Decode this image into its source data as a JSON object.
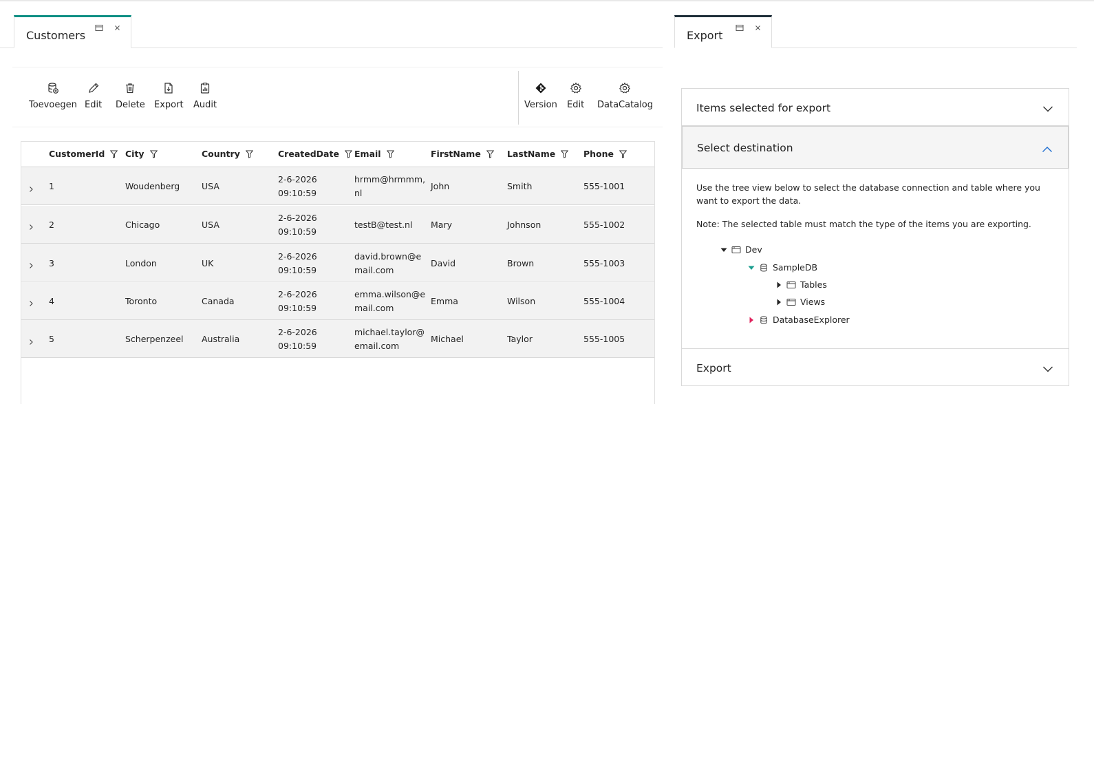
{
  "left_tab": {
    "title": "Customers"
  },
  "right_tab": {
    "title": "Export"
  },
  "toolbar": {
    "left_buttons": [
      {
        "label": "Toevoegen",
        "icon": "database-add-icon"
      },
      {
        "label": "Edit",
        "icon": "pencil-icon"
      },
      {
        "label": "Delete",
        "icon": "trash-icon"
      },
      {
        "label": "Export",
        "icon": "document-export-icon"
      },
      {
        "label": "Audit",
        "icon": "clipboard-chart-icon"
      }
    ],
    "right_buttons": [
      {
        "label": "Version",
        "icon": "git-diamond-icon"
      },
      {
        "label": "Edit",
        "icon": "gear-icon"
      },
      {
        "label": "DataCatalog",
        "icon": "gear-icon"
      }
    ]
  },
  "grid": {
    "columns": [
      "CustomerId",
      "City",
      "Country",
      "CreatedDate",
      "Email",
      "FirstName",
      "LastName",
      "Phone"
    ],
    "rows": [
      {
        "id": "1",
        "city": "Woudenberg",
        "country": "USA",
        "date": "2-6-2026",
        "time": "09:10:59",
        "email1": "hrmm@hrmmm,",
        "email2": "nl",
        "first": "John",
        "last": "Smith",
        "phone": "555-1001"
      },
      {
        "id": "2",
        "city": "Chicago",
        "country": "USA",
        "date": "2-6-2026",
        "time": "09:10:59",
        "email1": "testB@test.nl",
        "email2": "",
        "first": "Mary",
        "last": "Johnson",
        "phone": "555-1002"
      },
      {
        "id": "3",
        "city": "London",
        "country": "UK",
        "date": "2-6-2026",
        "time": "09:10:59",
        "email1": "david.brown@e",
        "email2": "mail.com",
        "first": "David",
        "last": "Brown",
        "phone": "555-1003"
      },
      {
        "id": "4",
        "city": "Toronto",
        "country": "Canada",
        "date": "2-6-2026",
        "time": "09:10:59",
        "email1": "emma.wilson@e",
        "email2": "mail.com",
        "first": "Emma",
        "last": "Wilson",
        "phone": "555-1004"
      },
      {
        "id": "5",
        "city": "Scherpenzeel",
        "country": "Australia",
        "date": "2-6-2026",
        "time": "09:10:59",
        "email1": "michael.taylor@",
        "email2": "email.com",
        "first": "Michael",
        "last": "Taylor",
        "phone": "555-1005"
      }
    ]
  },
  "export_panel": {
    "sections": [
      {
        "title": "Items selected for export",
        "expanded": false
      },
      {
        "title": "Select destination",
        "expanded": true
      },
      {
        "title": "Export",
        "expanded": false
      }
    ],
    "description": "Use the tree view below to select the database connection and table where you want to export the data.",
    "note": "Note: The selected table must match the type of the items you are exporting.",
    "tree": [
      {
        "label": "Dev",
        "icon": "folder-window-icon",
        "state": "expanded",
        "caret_color": "#242424"
      },
      {
        "label": "SampleDB",
        "icon": "database-icon",
        "state": "expanded",
        "caret_color": "#1a9e8f"
      },
      {
        "label": "Tables",
        "icon": "folder-window-icon",
        "state": "collapsed",
        "caret_color": "#242424"
      },
      {
        "label": "Views",
        "icon": "folder-window-icon",
        "state": "collapsed",
        "caret_color": "#242424"
      },
      {
        "label": "DatabaseExplorer",
        "icon": "database-icon",
        "state": "collapsed",
        "caret_color": "#e0245e"
      }
    ]
  },
  "colors": {
    "accent_teal": "#0f8f84",
    "tab_dark": "#1f2f3a",
    "chevron_blue": "#1f6fd1"
  }
}
